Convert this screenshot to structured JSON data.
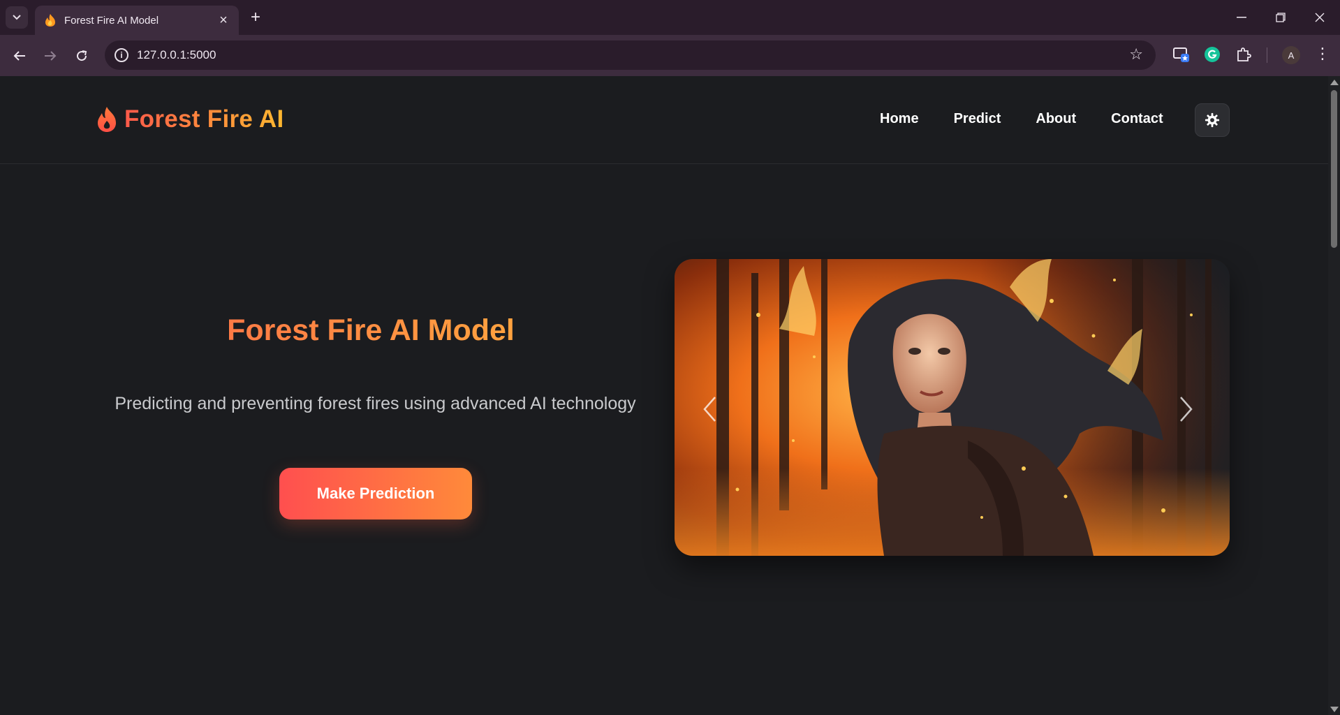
{
  "browser": {
    "tab_title": "Forest Fire AI Model",
    "url": "127.0.0.1:5000",
    "profile_initial": "A"
  },
  "site": {
    "brand": "Forest Fire AI",
    "nav": [
      "Home",
      "Predict",
      "About",
      "Contact"
    ],
    "theme_icon": "gear-icon"
  },
  "hero": {
    "title": "Forest Fire AI Model",
    "subtitle": "Predicting and preventing forest fires using advanced AI technology",
    "cta_label": "Make Prediction"
  },
  "colors": {
    "gradient_start": "#ff5a4a",
    "gradient_end": "#ffb830",
    "background": "#1b1c1f"
  }
}
